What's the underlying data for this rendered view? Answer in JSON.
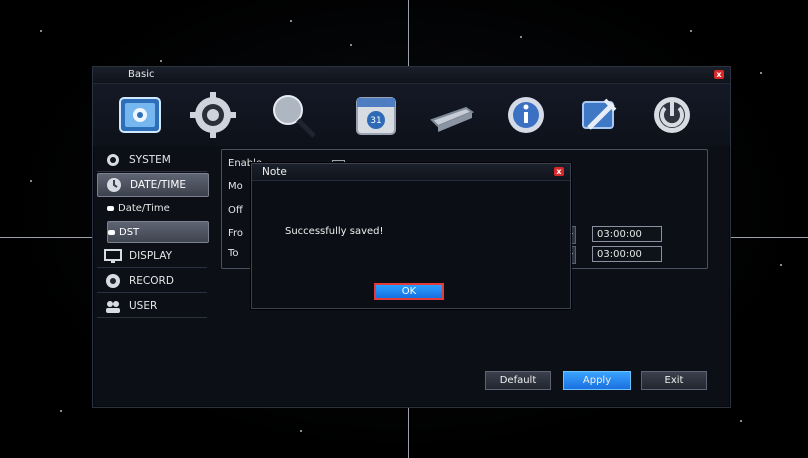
{
  "window": {
    "title": "Basic",
    "close_symbol": "x"
  },
  "toolbar": {
    "icons": [
      {
        "name": "basic-settings-icon"
      },
      {
        "name": "gear-icon"
      },
      {
        "name": "search-magnifier-icon"
      },
      {
        "name": "calendar-schedule-icon"
      },
      {
        "name": "hard-drive-icon"
      },
      {
        "name": "info-icon"
      },
      {
        "name": "tools-icon"
      },
      {
        "name": "power-icon"
      }
    ]
  },
  "sidebar": {
    "items": [
      {
        "label": "SYSTEM",
        "icon": "gear-icon"
      },
      {
        "label": "DATE/TIME",
        "icon": "clock-icon",
        "active": true
      },
      {
        "label": "DISPLAY",
        "icon": "monitor-icon"
      },
      {
        "label": "RECORD",
        "icon": "record-icon"
      },
      {
        "label": "USER",
        "icon": "users-icon"
      }
    ],
    "subitems": [
      {
        "label": "Date/Time"
      },
      {
        "label": "DST",
        "active": true
      }
    ]
  },
  "panel": {
    "labels": {
      "enable": "Enable",
      "mode": "Mo",
      "offset": "Off",
      "from": "Fro",
      "to": "To"
    },
    "times": {
      "from_time": "03:00:00",
      "to_time": "03:00:00"
    }
  },
  "buttons": {
    "default": "Default",
    "apply": "Apply",
    "exit": "Exit"
  },
  "modal": {
    "title": "Note",
    "message": "Successfully saved!",
    "ok": "OK"
  },
  "colors": {
    "accent": "#1a6fe0",
    "close_red": "#d62828",
    "highlight_border": "#e23b3b"
  }
}
